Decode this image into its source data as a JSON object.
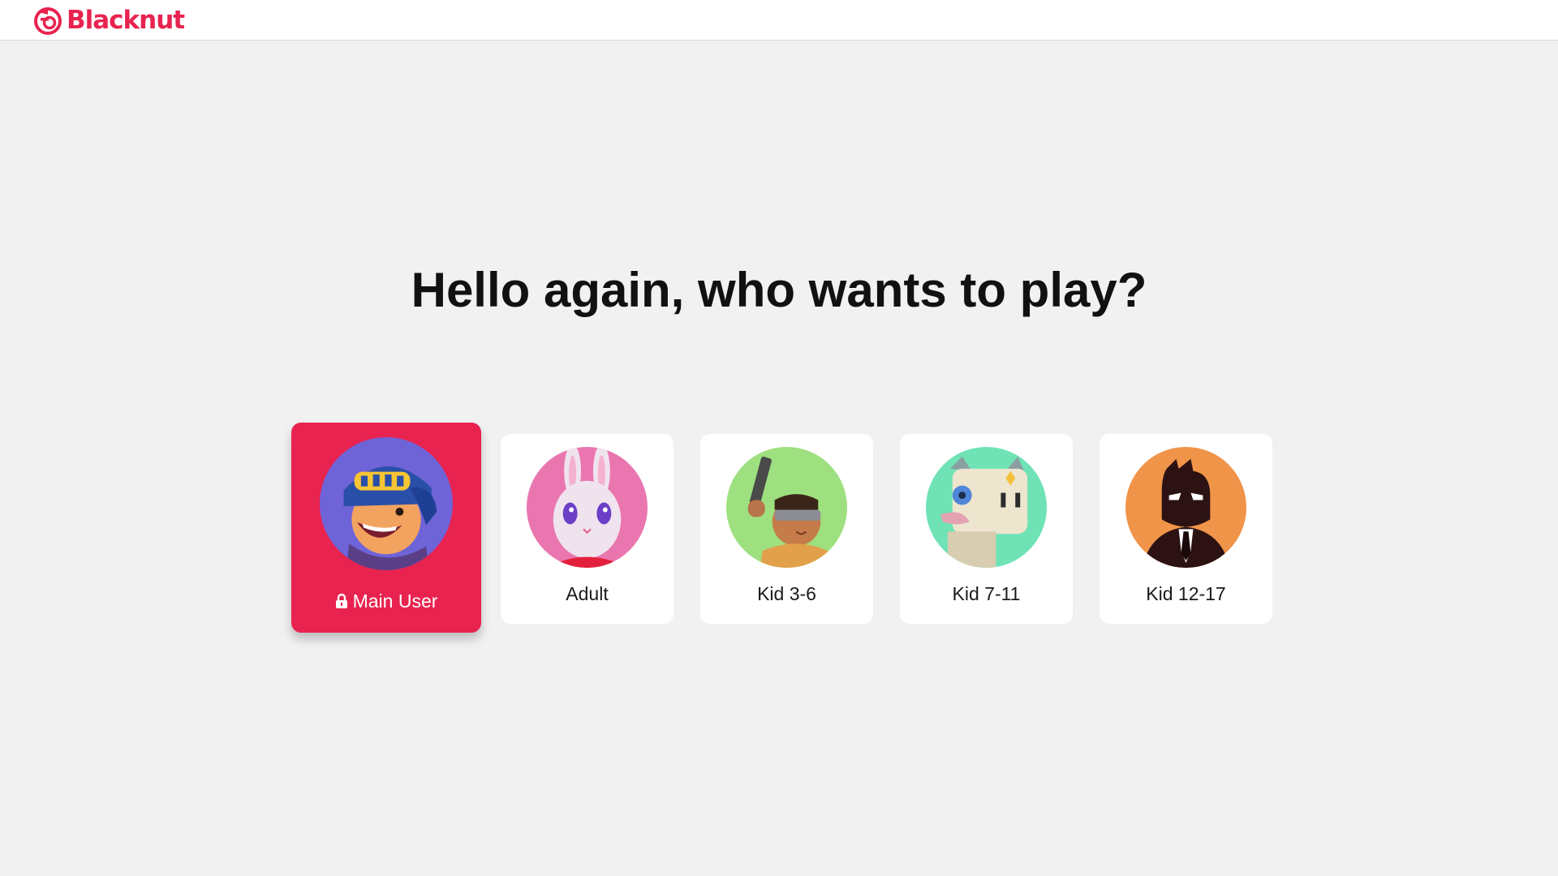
{
  "brand": {
    "name": "Blacknut",
    "color": "#e8234f"
  },
  "heading": "Hello again, who wants to play?",
  "profiles": [
    {
      "label": "Main User",
      "selected": true,
      "locked": true,
      "avatar": "helmet-kid-avatar",
      "avatar_bg": "#6f63d8"
    },
    {
      "label": "Adult",
      "selected": false,
      "locked": false,
      "avatar": "bunny-avatar",
      "avatar_bg": "#ea76b0"
    },
    {
      "label": "Kid 3-6",
      "selected": false,
      "locked": false,
      "avatar": "soldier-avatar",
      "avatar_bg": "#9ee07f"
    },
    {
      "label": "Kid 7-11",
      "selected": false,
      "locked": false,
      "avatar": "robot-cat-avatar",
      "avatar_bg": "#6fe3b5"
    },
    {
      "label": "Kid 12-17",
      "selected": false,
      "locked": false,
      "avatar": "agent-avatar",
      "avatar_bg": "#f0944a"
    }
  ],
  "icons": {
    "lock": "lock-icon",
    "logo": "blacknut-logo-icon"
  }
}
